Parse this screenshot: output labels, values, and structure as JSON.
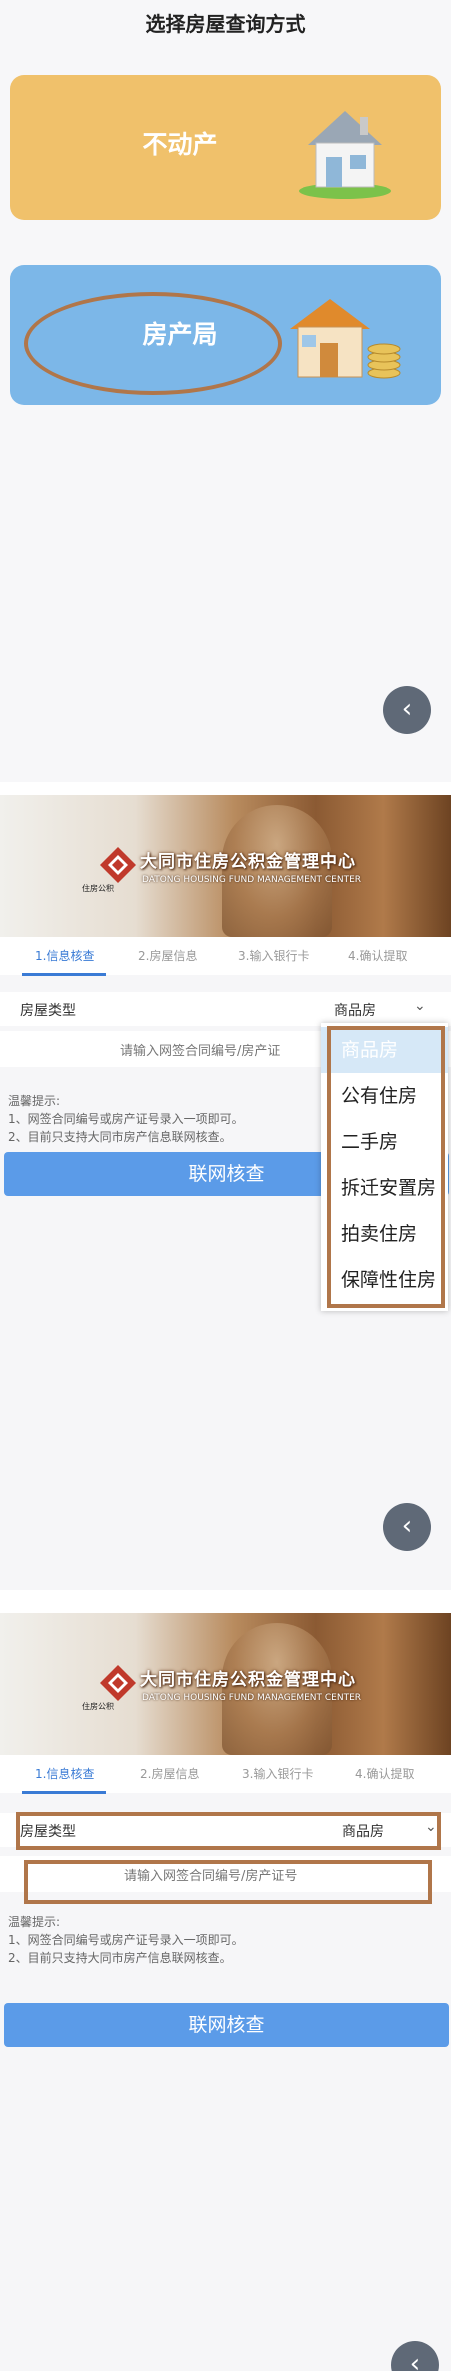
{
  "screen1": {
    "title": "选择房屋查询方式",
    "cards": [
      {
        "label": "不动产"
      },
      {
        "label": "房产局"
      }
    ]
  },
  "header": {
    "org_cn": "大同市住房公积金管理中心",
    "org_en": "DATONG HOUSING FUND MANAGEMENT CENTER",
    "logo_text": "住房公积"
  },
  "steps": [
    "1.信息核查",
    "2.房屋信息",
    "3.输入银行卡",
    "4.确认提取"
  ],
  "form": {
    "house_type_label": "房屋类型",
    "house_type_value": "商品房",
    "contract_placeholder": "请输入网签合同编号/房产证号",
    "contract_placeholder_cut": "请输入网签合同编号/房产证",
    "tips_title": "温馨提示:",
    "tip1": "1、网签合同编号或房产证号录入一项即可。",
    "tip2": "2、目前只支持大同市房产信息联网核查。",
    "submit_label": "联网核查"
  },
  "dropdown": {
    "options": [
      "商品房",
      "公有住房",
      "二手房",
      "拆迁安置房",
      "拍卖住房",
      "保障性住房"
    ],
    "selected_index": 0
  },
  "colors": {
    "orange_card": "#f0c16b",
    "blue_card": "#7cb7e8",
    "primary": "#5b9be8",
    "annotation": "#b0764a",
    "active_step": "#3a7bd5"
  },
  "icons": {
    "back": "chevron-left-icon",
    "select": "chevron-down-icon"
  }
}
